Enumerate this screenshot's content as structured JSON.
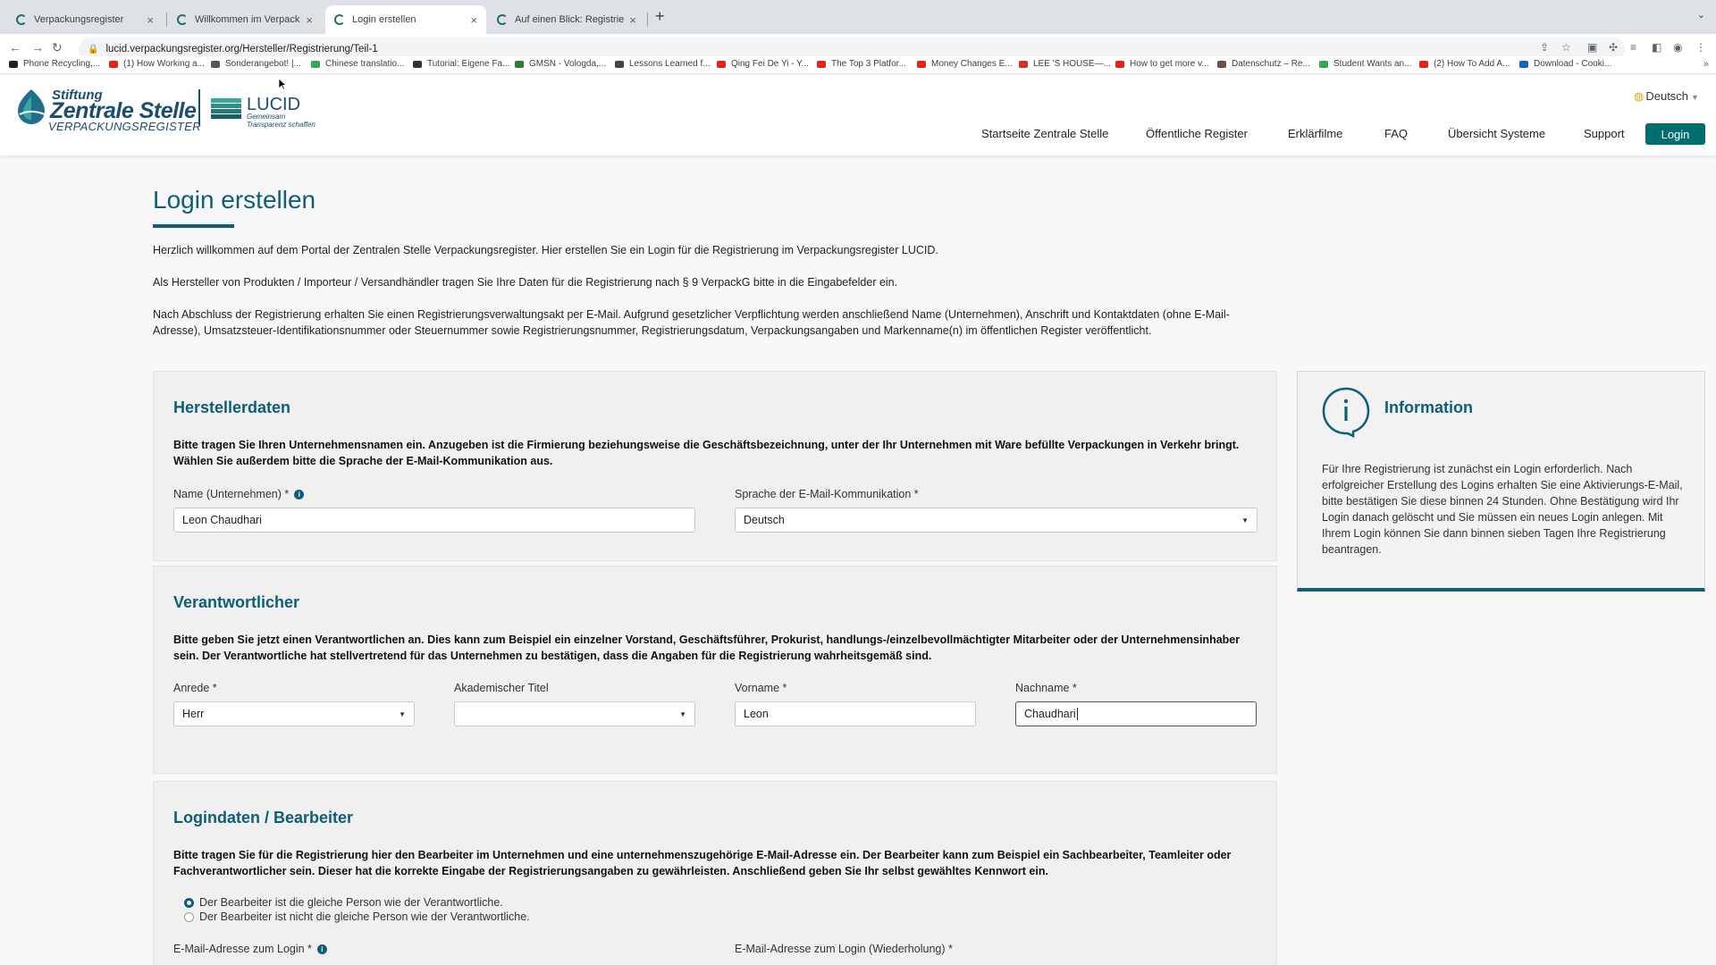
{
  "browser": {
    "tabs": [
      {
        "title": "Verpackungsregister",
        "active": false
      },
      {
        "title": "Willkommen im Verpackungsre",
        "active": false
      },
      {
        "title": "Login erstellen",
        "active": true
      },
      {
        "title": "Auf einen Blick: Registrierung",
        "active": false
      }
    ],
    "close_glyph": "×",
    "new_tab_glyph": "+",
    "url": "lucid.verpackungsregister.org/Hersteller/Registrierung/Teil-1",
    "bookmarks": [
      {
        "label": "Phone Recycling,...",
        "icon_color": "#222222"
      },
      {
        "label": "(1) How Working a...",
        "icon_color": "#e62117"
      },
      {
        "label": "Sonderangebot! |...",
        "icon_color": "#555555"
      },
      {
        "label": "Chinese translatio...",
        "icon_color": "#34a853"
      },
      {
        "label": "Tutorial: Eigene Fa...",
        "icon_color": "#333333"
      },
      {
        "label": "GMSN - Vologda,...",
        "icon_color": "#2e7d32"
      },
      {
        "label": "Lessons Learned f...",
        "icon_color": "#444444"
      },
      {
        "label": "Qing Fei De Yi - Y...",
        "icon_color": "#e62117"
      },
      {
        "label": "The Top 3 Platfor...",
        "icon_color": "#e62117"
      },
      {
        "label": "Money Changes E...",
        "icon_color": "#e62117"
      },
      {
        "label": "LEE 'S HOUSE—...",
        "icon_color": "#d32f2f"
      },
      {
        "label": "How to get more v...",
        "icon_color": "#e62117"
      },
      {
        "label": "Datenschutz – Re...",
        "icon_color": "#6d4c41"
      },
      {
        "label": "Student Wants an...",
        "icon_color": "#34a853"
      },
      {
        "label": "(2) How To Add A...",
        "icon_color": "#e62117"
      },
      {
        "label": "Download - Cooki...",
        "icon_color": "#1565c0"
      }
    ]
  },
  "header": {
    "logo_line1": "Stiftung",
    "logo_line2": "Zentrale Stelle",
    "logo_line3": "VERPACKUNGSREGISTER",
    "lucid_name": "LUCID",
    "lucid_tagline": "Gemeinsam Transparenz schaffen",
    "language": "Deutsch",
    "nav": [
      "Startseite Zentrale Stelle",
      "Öffentliche Register",
      "Erklärfilme",
      "FAQ",
      "Übersicht Systeme",
      "Support"
    ],
    "login_label": "Login"
  },
  "page": {
    "title": "Login erstellen",
    "intro": [
      "Herzlich willkommen auf dem Portal der Zentralen Stelle Verpackungsregister. Hier erstellen Sie ein Login für die Registrierung im Verpackungsregister LUCID.",
      "Als Hersteller von Produkten / Importeur / Versandhändler tragen Sie Ihre Daten für die Registrierung nach § 9 VerpackG bitte in die Eingabefelder ein.",
      "Nach Abschluss der Registrierung erhalten Sie einen Registrierungsverwaltungsakt per E-Mail. Aufgrund gesetzlicher Verpflichtung werden anschließend Name (Unternehmen), Anschrift und Kontaktdaten (ohne E-Mail-Adresse), Umsatzsteuer-Identifikationsnummer oder Steuernummer sowie Registrierungsnummer, Registrierungsdatum, Verpackungsangaben und Markenname(n) im öffentlichen Register veröffentlicht."
    ]
  },
  "herstellerdaten": {
    "title": "Herstellerdaten",
    "description": "Bitte tragen Sie Ihren Unternehmensnamen ein. Anzugeben ist die Firmierung beziehungsweise die Geschäftsbezeichnung, unter der Ihr Unternehmen mit Ware befüllte Verpackungen in Verkehr bringt. Wählen Sie außerdem bitte die Sprache der E-Mail-Kommunikation aus.",
    "name_label": "Name (Unternehmen) *",
    "name_value": "Leon Chaudhari",
    "language_label": "Sprache der E-Mail-Kommunikation *",
    "language_value": "Deutsch"
  },
  "verantwortlicher": {
    "title": "Verantwortlicher",
    "description": "Bitte geben Sie jetzt einen Verantwortlichen an. Dies kann zum Beispiel ein einzelner Vorstand, Geschäftsführer, Prokurist, handlungs-/einzelbevollmächtigter Mitarbeiter oder der Unternehmensinhaber sein. Der Verantwortliche hat stellvertretend für das Unternehmen zu bestätigen, dass die Angaben für die Registrierung wahrheitsgemäß sind.",
    "anrede_label": "Anrede *",
    "anrede_value": "Herr",
    "titel_label": "Akademischer Titel",
    "titel_value": "",
    "vorname_label": "Vorname *",
    "vorname_value": "Leon",
    "nachname_label": "Nachname *",
    "nachname_value": "Chaudhari"
  },
  "logindaten": {
    "title": "Logindaten / Bearbeiter",
    "description": "Bitte tragen Sie für die Registrierung hier den Bearbeiter im Unternehmen und eine unternehmenszugehörige E-Mail-Adresse ein. Der Bearbeiter kann zum Beispiel ein Sachbearbeiter, Teamleiter oder Fachverantwortlicher sein. Dieser hat die korrekte Eingabe der Registrierungsangaben zu gewährleisten. Anschließend geben Sie Ihr selbst gewähltes Kennwort ein.",
    "radio_same": "Der Bearbeiter ist die gleiche Person wie der Verantwortliche.",
    "radio_other": "Der Bearbeiter ist nicht die gleiche Person wie der Verantwortliche.",
    "selected": "same",
    "email_label": "E-Mail-Adresse zum Login *",
    "email_repeat_label": "E-Mail-Adresse zum Login (Wiederholung) *"
  },
  "info_box": {
    "title": "Information",
    "icon_glyph": "i",
    "text": "Für Ihre Registrierung ist zunächst ein Login erforderlich. Nach erfolgreicher Erstellung des Logins erhalten Sie eine Aktivierungs-E-Mail, bitte bestätigen Sie diese binnen 24 Stunden. Ohne Bestätigung wird Ihr Login danach gelöscht und Sie müssen ein neues Login anlegen. Mit Ihrem Login können Sie dann binnen sieben Tagen Ihre Registrierung beantragen."
  },
  "colors": {
    "accent": "#0e5e78",
    "button": "#006e6e",
    "logo_blue": "#1b4d6e",
    "section_bg": "#f0f0f0"
  },
  "icons": {
    "info_small": "info-circle-icon",
    "select_caret": "triangle-down-icon",
    "globe": "globe-icon"
  }
}
